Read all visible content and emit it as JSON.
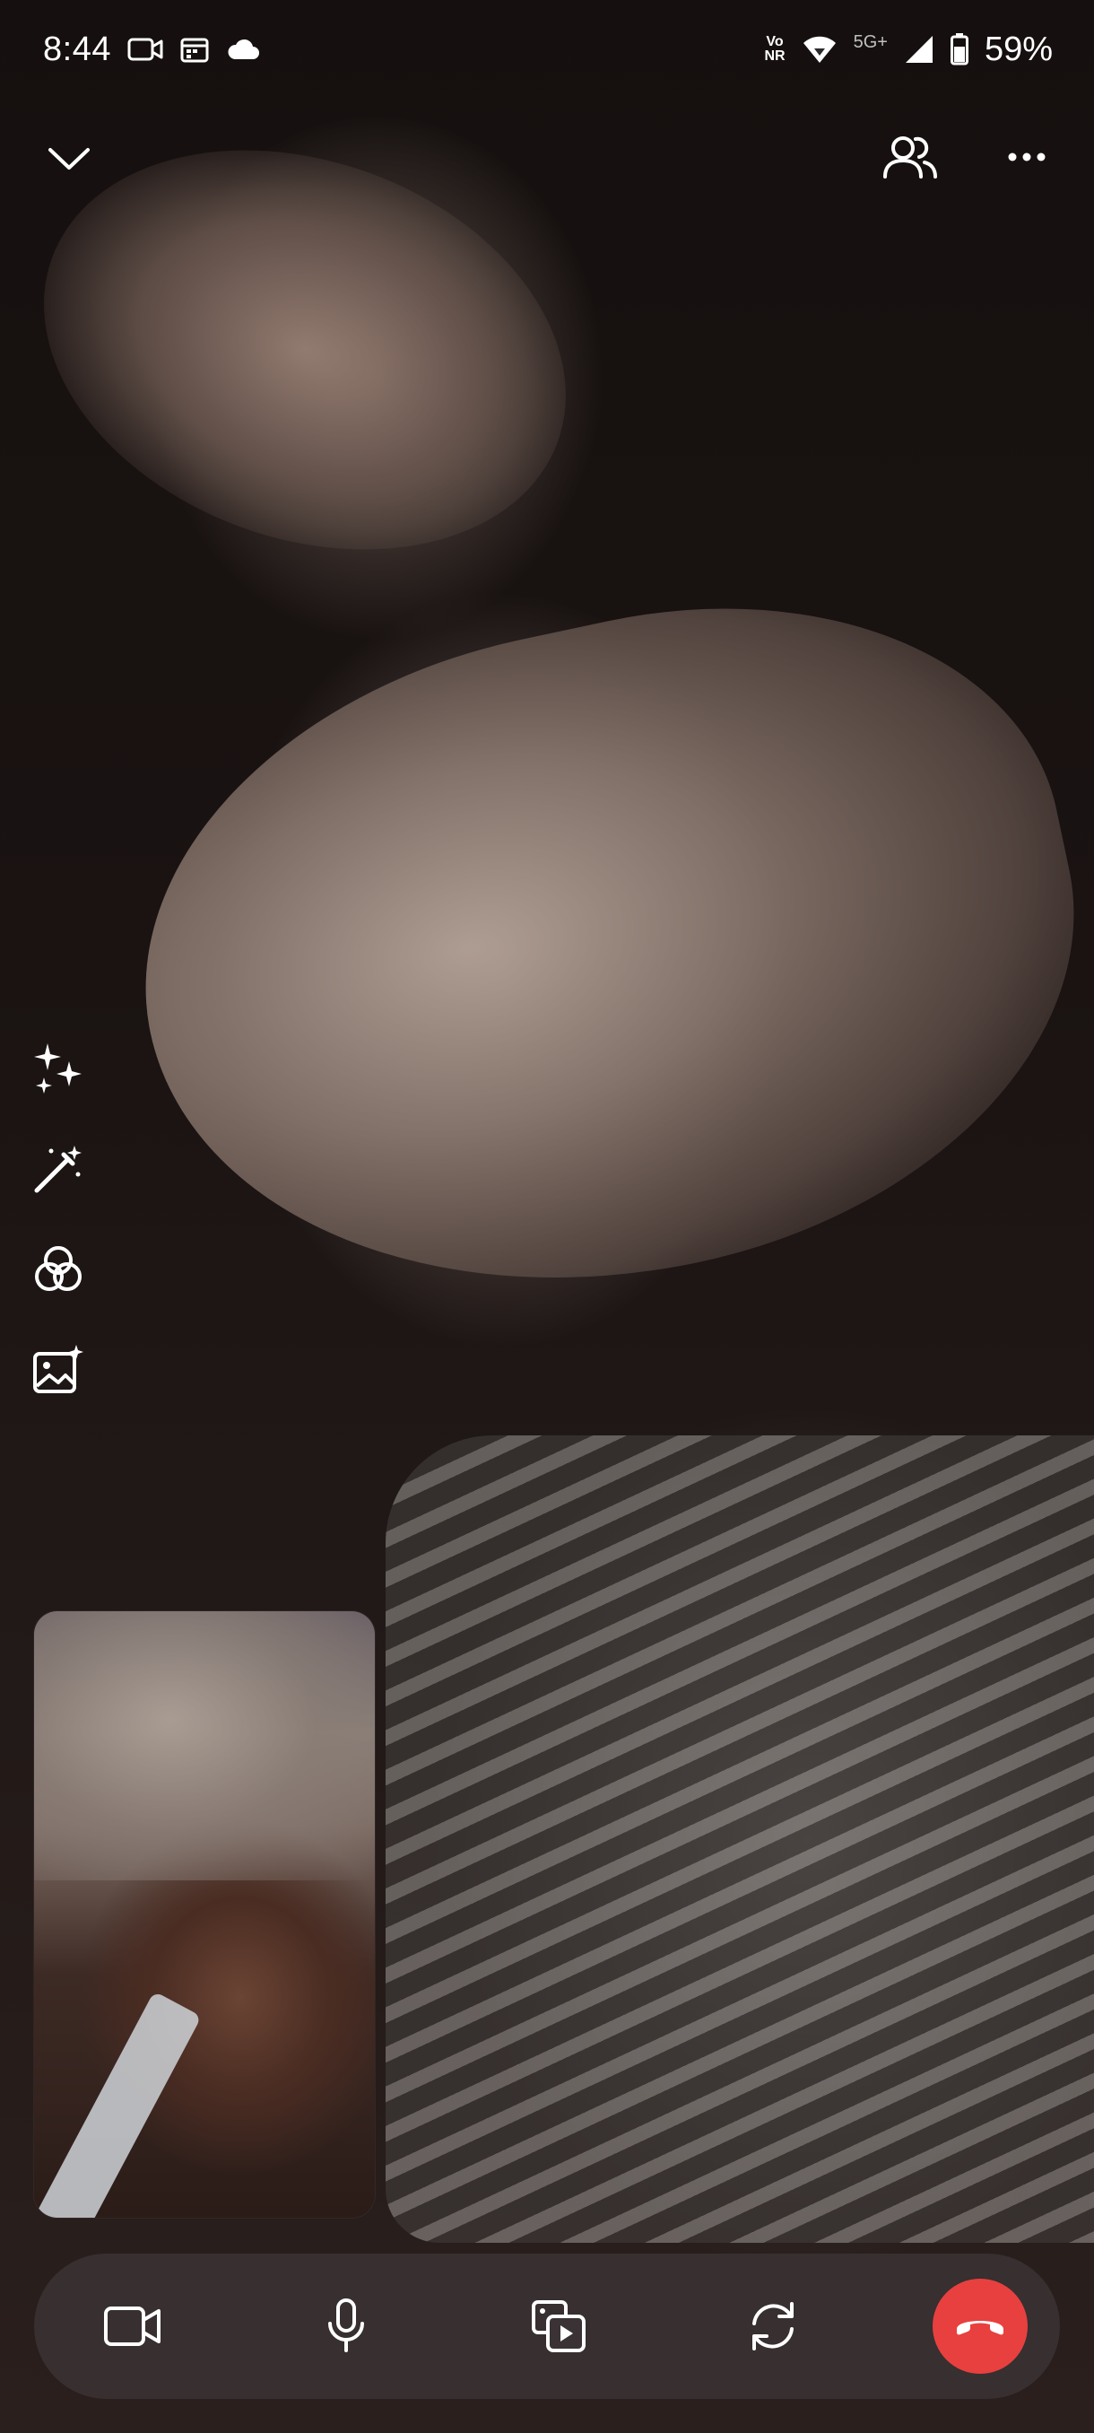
{
  "status_bar": {
    "time": "8:44",
    "volte_top": "Vo",
    "volte_bottom": "NR",
    "network": "5G+",
    "battery": "59%",
    "icons": [
      "video-camera-icon",
      "calendar-icon",
      "cloud-icon",
      "volte-icon",
      "wifi-icon",
      "signal-icon",
      "battery-icon"
    ]
  },
  "top_controls": {
    "collapse_icon": "chevron-down-icon",
    "participants_icon": "participants-icon",
    "more_icon": "more-options-icon"
  },
  "effects": {
    "items": [
      "sparkles-icon",
      "magic-wand-icon",
      "filters-icon",
      "background-image-icon"
    ]
  },
  "self_view": {
    "label": ""
  },
  "control_bar": {
    "items": [
      "video-camera-icon",
      "microphone-icon",
      "share-media-icon",
      "switch-camera-icon",
      "end-call-icon"
    ],
    "end_call_color": "#e8403f"
  },
  "colors": {
    "end_call": "#e8403f",
    "bar_background": "#3a3234"
  }
}
